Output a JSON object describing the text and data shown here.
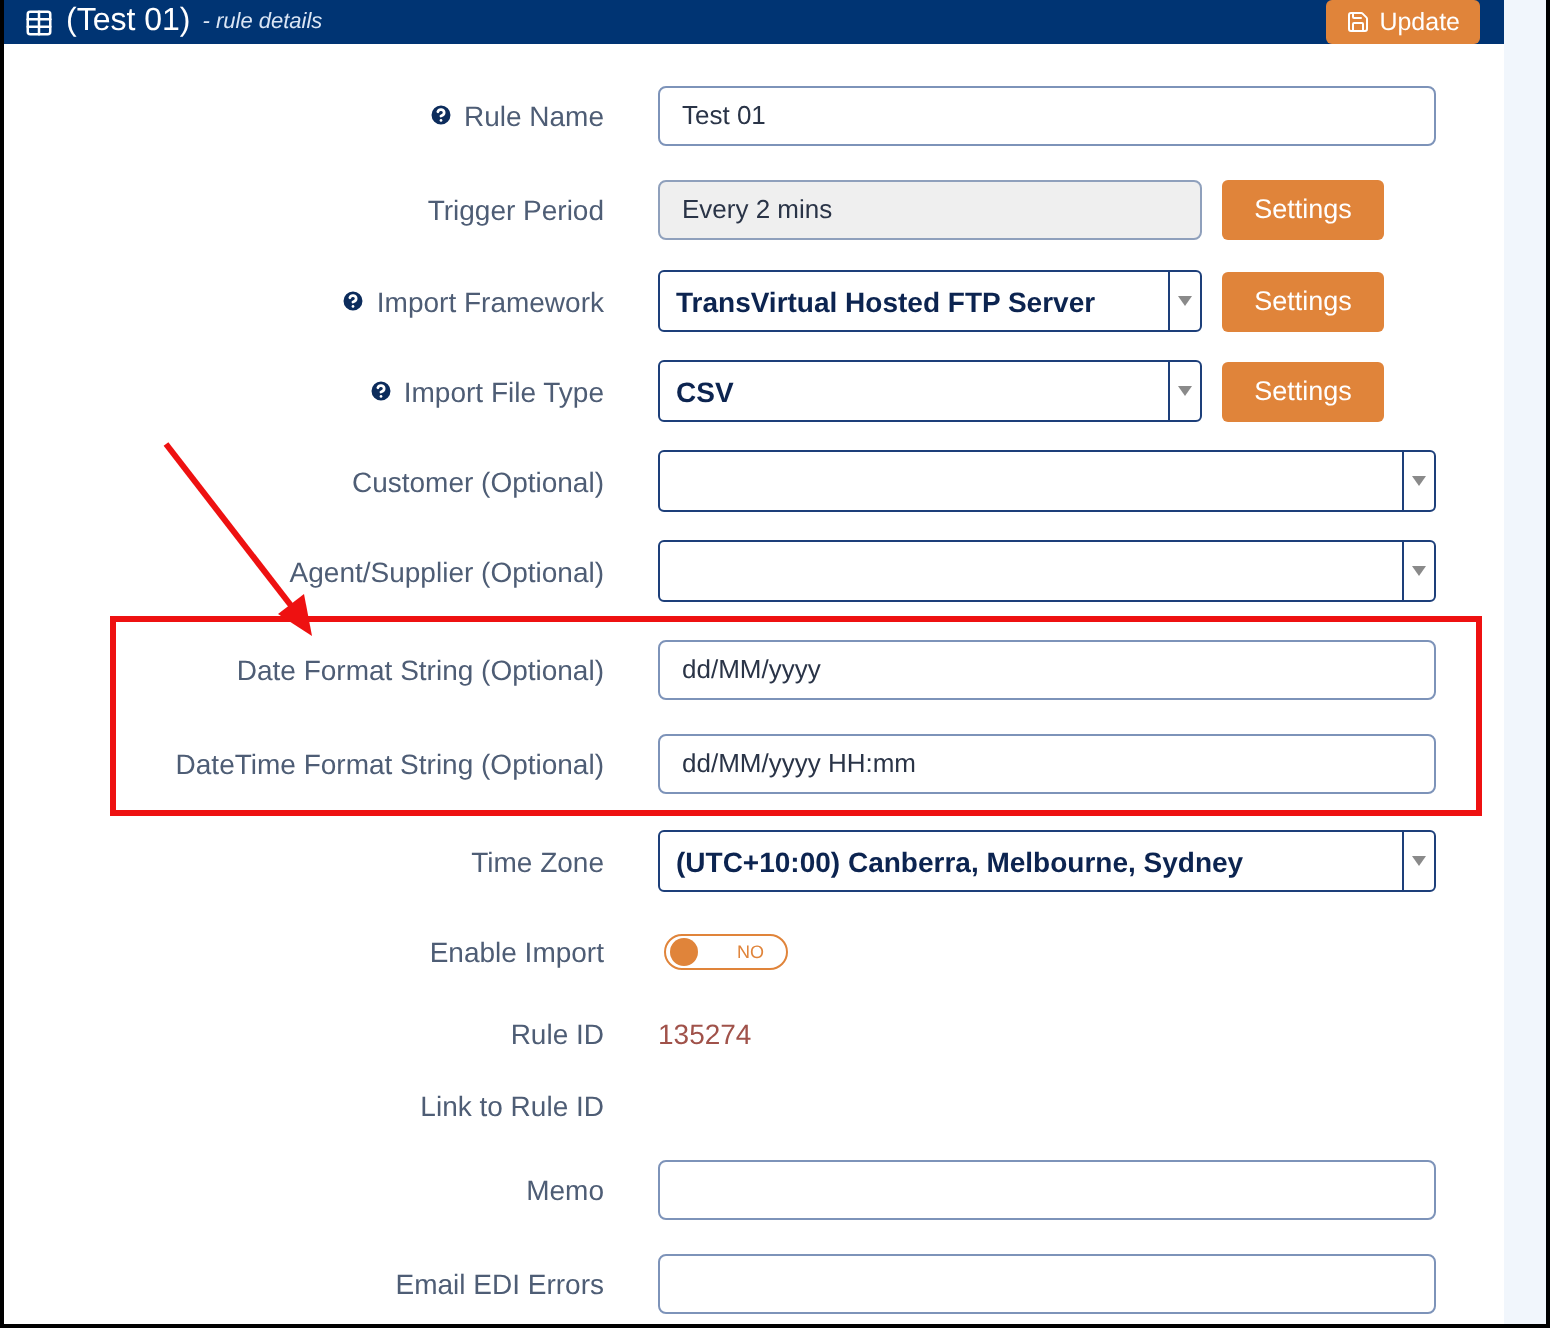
{
  "header": {
    "title": "(Test 01)",
    "subtitle": "- rule details",
    "update_button": "Update"
  },
  "rows": [
    {
      "kind": "text",
      "label": "Rule Name",
      "help": true,
      "value": "Test 01",
      "readonly": false
    },
    {
      "kind": "text",
      "label": "Trigger Period",
      "help": false,
      "value": "Every 2 mins",
      "readonly": true,
      "button": "Settings"
    },
    {
      "kind": "select",
      "label": "Import Framework",
      "help": true,
      "value": "TransVirtual Hosted FTP Server",
      "button": "Settings"
    },
    {
      "kind": "select",
      "label": "Import File Type",
      "help": true,
      "value": "CSV",
      "button": "Settings"
    },
    {
      "kind": "select",
      "label": "Customer (Optional)",
      "help": false,
      "value": ""
    },
    {
      "kind": "select",
      "label": "Agent/Supplier (Optional)",
      "help": false,
      "value": ""
    },
    {
      "kind": "text",
      "label": "Date Format String (Optional)",
      "help": false,
      "value": "dd/MM/yyyy",
      "readonly": false,
      "highlighted": true
    },
    {
      "kind": "text",
      "label": "DateTime Format String (Optional)",
      "help": false,
      "value": "dd/MM/yyyy HH:mm",
      "readonly": false,
      "highlighted": true
    },
    {
      "kind": "select",
      "label": "Time Zone",
      "help": false,
      "value": "(UTC+10:00) Canberra, Melbourne, Sydney"
    },
    {
      "kind": "toggle",
      "label": "Enable Import",
      "help": false,
      "on": false,
      "toggle_text": "NO"
    },
    {
      "kind": "value",
      "label": "Rule ID",
      "help": false,
      "value": "135274"
    },
    {
      "kind": "value",
      "label": "Link to Rule ID",
      "help": false,
      "value": ""
    },
    {
      "kind": "text",
      "label": "Memo",
      "help": false,
      "value": "",
      "readonly": false
    },
    {
      "kind": "text",
      "label": "Email EDI Errors",
      "help": false,
      "value": "",
      "readonly": false
    }
  ]
}
